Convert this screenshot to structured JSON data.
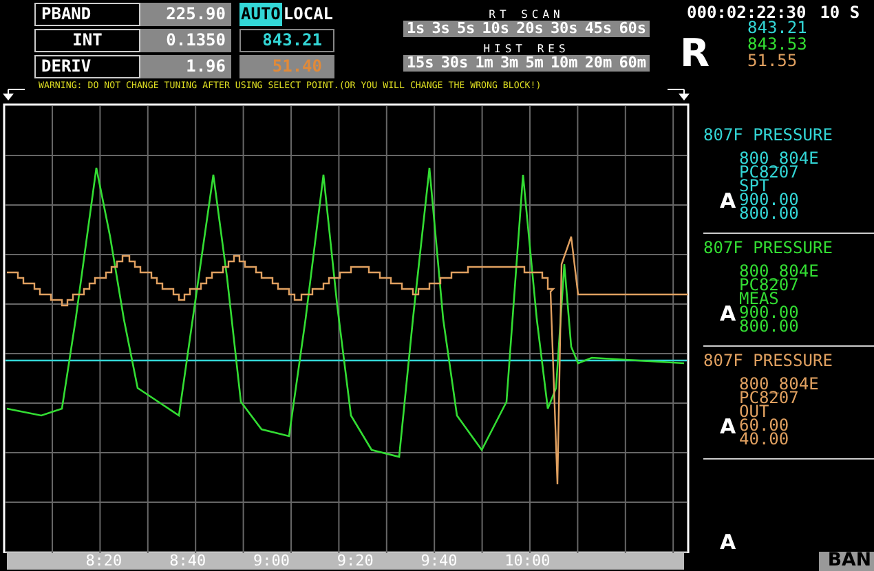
{
  "header": {
    "tuning": [
      {
        "label": "PBAND",
        "value": "225.90"
      },
      {
        "label": "INT",
        "value": "0.1350"
      },
      {
        "label": "DERIV",
        "value": "1.96"
      }
    ],
    "mode": [
      {
        "label": "AUTO",
        "selected": true
      },
      {
        "label": "LOCAL",
        "selected": false
      }
    ],
    "readouts": [
      {
        "value": "843.21",
        "color": "#33d6d6",
        "shaded": false
      },
      {
        "value": "51.40",
        "color": "#e08a3a",
        "shaded": true
      }
    ],
    "rt_scan": {
      "title": "RT SCAN",
      "options": [
        "1s",
        "3s",
        "5s",
        "10s",
        "20s",
        "30s",
        "45s",
        "60s"
      ]
    },
    "hist_res": {
      "title": "HIST RES",
      "options": [
        "15s",
        "30s",
        "1m",
        "3m",
        "5m",
        "10m",
        "20m",
        "60m"
      ]
    },
    "warning": "WARNING: DO NOT CHANGE TUNING AFTER USING SELECT POINT.(OR YOU WILL CHANGE THE WRONG BLOCK!)"
  },
  "clock": "000:02:22:30",
  "interval": "10 S",
  "status_letter": "R",
  "current_values": [
    {
      "value": "843.21",
      "color": "#33d6d6"
    },
    {
      "value": "843.53",
      "color": "#33dd33"
    },
    {
      "value": "51.55",
      "color": "#e0a060"
    }
  ],
  "panels": [
    {
      "title": "807F PRESSURE",
      "color": "#33d6d6",
      "lines": [
        "800_804E",
        "PC8207",
        "SPT",
        "900.00",
        "800.00"
      ],
      "marker": "A"
    },
    {
      "title": "807F PRESSURE",
      "color": "#33dd33",
      "lines": [
        "800_804E",
        "PC8207",
        "MEAS",
        "900.00",
        "800.00"
      ],
      "marker": "A"
    },
    {
      "title": "807F PRESSURE",
      "color": "#e0a060",
      "lines": [
        "800_804E",
        "PC8207",
        "OUT",
        "60.00",
        "40.00"
      ],
      "marker": "A"
    },
    {
      "marker": "A"
    }
  ],
  "time_axis": [
    "8:20",
    "8:40",
    "9:00",
    "9:20",
    "9:40",
    "10:00"
  ],
  "band_button": "BAN"
}
